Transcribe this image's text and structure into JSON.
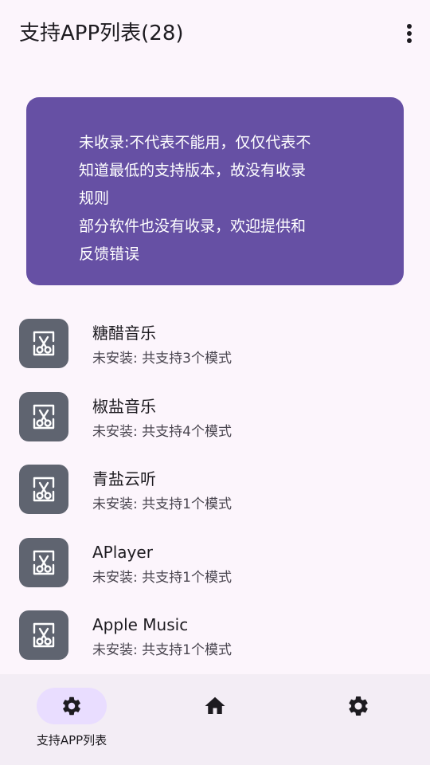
{
  "app_bar": {
    "title": "支持APP列表(28)",
    "more_icon": "more-vert-icon"
  },
  "notice": {
    "lines": [
      "未收录:不代表不能用，仅仅代表不",
      "知道最低的支持版本，故没有收录",
      "规则",
      "部分软件也没有收录，欢迎提供和",
      "反馈错误"
    ],
    "background_color": "#6650a4"
  },
  "apps": [
    {
      "name": "糖醋音乐",
      "status": "未安装: 共支持3个模式",
      "icon": "scissors-frame-icon"
    },
    {
      "name": "椒盐音乐",
      "status": "未安装: 共支持4个模式",
      "icon": "scissors-frame-icon"
    },
    {
      "name": "青盐云听",
      "status": "未安装: 共支持1个模式",
      "icon": "scissors-frame-icon"
    },
    {
      "name": "APlayer",
      "status": "未安装: 共支持1个模式",
      "icon": "scissors-frame-icon"
    },
    {
      "name": "Apple Music",
      "status": "未安装: 共支持1个模式",
      "icon": "scissors-frame-icon"
    }
  ],
  "bottom_nav": {
    "items": [
      {
        "label": "支持APP列表",
        "icon": "gear-icon",
        "active": true
      },
      {
        "label": "",
        "icon": "home-icon",
        "active": false
      },
      {
        "label": "",
        "icon": "gear-icon",
        "active": false
      }
    ],
    "active_color": "#e9ddff"
  }
}
